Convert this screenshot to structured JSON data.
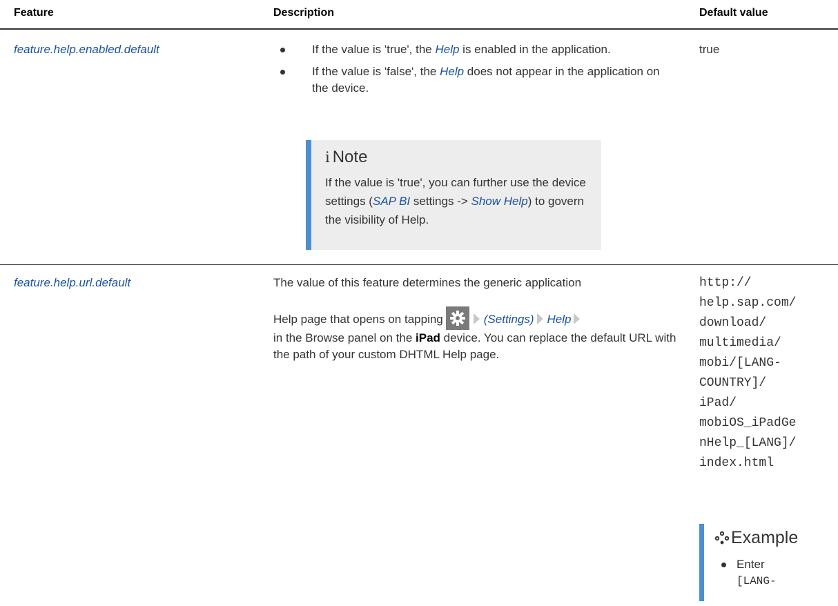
{
  "headers": {
    "feature": "Feature",
    "description": "Description",
    "default_value": "Default value"
  },
  "rows": [
    {
      "feature": "feature.help.enabled.default",
      "bullet1": {
        "a": "If the value is 'true', the ",
        "link": "Help",
        "b": " is enabled in the application."
      },
      "bullet2": {
        "a": "If the value is 'false', the ",
        "link": "Help",
        "b": " does not appear in the application on the device."
      },
      "note": {
        "title": "Note",
        "text_a": "If the value is 'true', you can further use the device settings (",
        "link1": "SAP BI",
        "text_b": " settings -> ",
        "link2": "Show Help",
        "text_c": ") to govern the visibility of Help."
      },
      "default": "true"
    },
    {
      "feature": "feature.help.url.default",
      "desc_line1": "The value of this feature determines the generic application",
      "desc_a": "Help page that opens on tapping",
      "settings_link": "(Settings)",
      "help_link": "Help",
      "desc_b": "in the Browse panel on the ",
      "device": "iPad",
      "desc_c": " device. You can replace the default URL with the path of your custom DHTML Help page.",
      "default_lines": [
        "http://",
        "help.sap.com/",
        "download/",
        "multimedia/",
        "mobi/[LANG-",
        "COUNTRY]/",
        "iPad/",
        "mobiOS_iPadGe",
        "nHelp_[LANG]/",
        "index.html"
      ],
      "example": {
        "title": "Example",
        "item_text": "Enter",
        "item_code": "[LANG-"
      }
    }
  ],
  "icons": {
    "gear": "gear-icon",
    "example": "example-icon",
    "note": "info-icon"
  },
  "colors": {
    "link": "#1a52a3",
    "accent_bar": "#4a90d0",
    "note_bg": "#ededed"
  }
}
